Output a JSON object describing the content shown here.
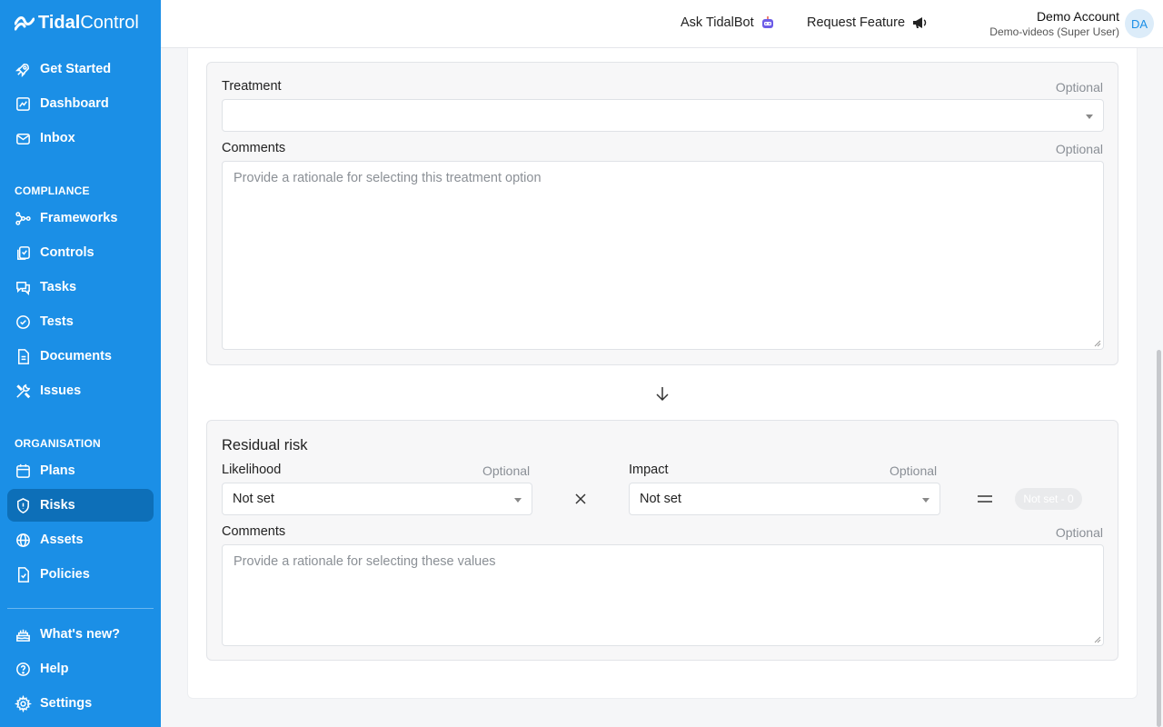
{
  "brand": {
    "strong": "Tidal",
    "light": "Control"
  },
  "sidebar": {
    "top_items": [
      {
        "label": "Get Started",
        "icon": "rocket-icon"
      },
      {
        "label": "Dashboard",
        "icon": "chart-icon"
      },
      {
        "label": "Inbox",
        "icon": "mail-icon"
      }
    ],
    "compliance_label": "COMPLIANCE",
    "compliance_items": [
      {
        "label": "Frameworks",
        "icon": "framework-icon"
      },
      {
        "label": "Controls",
        "icon": "controls-icon"
      },
      {
        "label": "Tasks",
        "icon": "chat-icon"
      },
      {
        "label": "Tests",
        "icon": "check-circle-icon"
      },
      {
        "label": "Documents",
        "icon": "document-icon"
      },
      {
        "label": "Issues",
        "icon": "tools-icon"
      }
    ],
    "organisation_label": "ORGANISATION",
    "organisation_items": [
      {
        "label": "Plans",
        "icon": "calendar-icon"
      },
      {
        "label": "Risks",
        "icon": "shield-icon",
        "active": true
      },
      {
        "label": "Assets",
        "icon": "globe-icon"
      },
      {
        "label": "Policies",
        "icon": "policy-icon"
      }
    ],
    "bottom_items": [
      {
        "label": "What's new?",
        "icon": "cake-icon"
      },
      {
        "label": "Help",
        "icon": "help-icon"
      },
      {
        "label": "Settings",
        "icon": "gear-icon"
      }
    ]
  },
  "header": {
    "ask_bot": "Ask TidalBot",
    "request_feature": "Request Feature",
    "user_name": "Demo Account",
    "user_role": "Demo-videos (Super User)",
    "avatar_initials": "DA"
  },
  "treatment": {
    "label": "Treatment",
    "optional": "Optional",
    "value": "",
    "comments_label": "Comments",
    "comments_optional": "Optional",
    "comments_placeholder": "Provide a rationale for selecting this treatment option"
  },
  "residual": {
    "title": "Residual risk",
    "likelihood_label": "Likelihood",
    "likelihood_optional": "Optional",
    "likelihood_value": "Not set",
    "impact_label": "Impact",
    "impact_optional": "Optional",
    "impact_value": "Not set",
    "score": "Not set - 0",
    "comments_label": "Comments",
    "comments_optional": "Optional",
    "comments_placeholder": "Provide a rationale for selecting these values"
  },
  "colors": {
    "sidebar": "#1b8fe6",
    "active_item": "#0d6fb8"
  }
}
